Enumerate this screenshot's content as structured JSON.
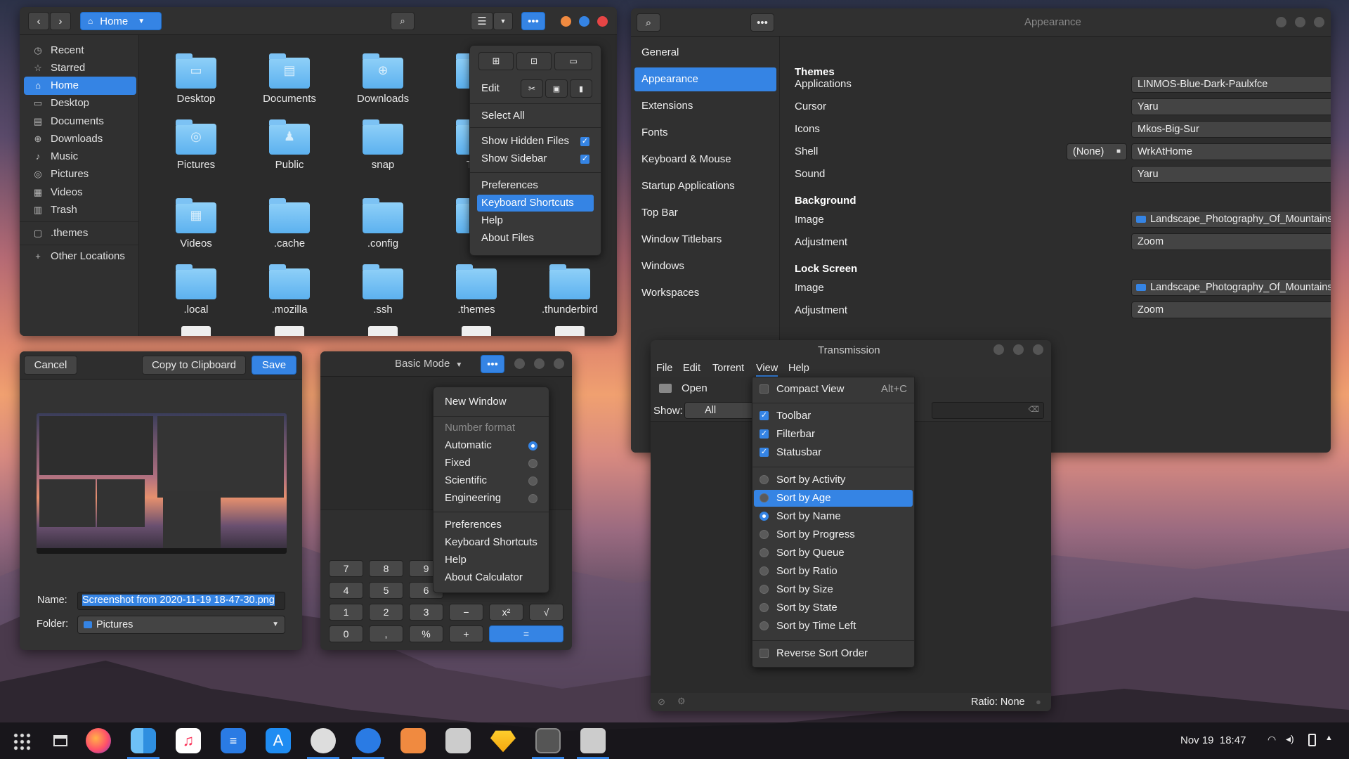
{
  "files": {
    "path": "Home",
    "sidebar": [
      {
        "label": "Recent",
        "icon": "clock-icon"
      },
      {
        "label": "Starred",
        "icon": "star-icon"
      },
      {
        "label": "Home",
        "icon": "home-icon"
      },
      {
        "label": "Desktop",
        "icon": "desktop-icon"
      },
      {
        "label": "Documents",
        "icon": "document-icon"
      },
      {
        "label": "Downloads",
        "icon": "download-icon"
      },
      {
        "label": "Music",
        "icon": "music-icon"
      },
      {
        "label": "Pictures",
        "icon": "camera-icon"
      },
      {
        "label": "Videos",
        "icon": "film-icon"
      },
      {
        "label": "Trash",
        "icon": "trash-icon"
      },
      {
        "label": ".themes",
        "icon": "folder-icon"
      },
      {
        "label": "Other Locations",
        "icon": "plus-icon"
      }
    ],
    "folders": [
      "Desktop",
      "Documents",
      "Downloads",
      "gi",
      "Pictures",
      "Public",
      "snap",
      "Tem",
      "Videos",
      ".cache",
      ".config",
      ".gi",
      ".local",
      ".mozilla",
      ".ssh",
      ".themes",
      ".thunderbird"
    ],
    "menu": {
      "edit": "Edit",
      "select_all": "Select All",
      "show_hidden": "Show Hidden Files",
      "show_sidebar": "Show Sidebar",
      "preferences": "Preferences",
      "shortcuts": "Keyboard Shortcuts",
      "help": "Help",
      "about": "About Files"
    }
  },
  "appearance": {
    "title": "Appearance",
    "nav": [
      "General",
      "Appearance",
      "Extensions",
      "Fonts",
      "Keyboard & Mouse",
      "Startup Applications",
      "Top Bar",
      "Window Titlebars",
      "Windows",
      "Workspaces"
    ],
    "themes": "Themes",
    "applications": "Applications",
    "applications_value": "LINMOS-Blue-Dark-Paulxfce",
    "cursor": "Cursor",
    "cursor_value": "Yaru",
    "icons": "Icons",
    "icons_value": "Mkos-Big-Sur",
    "shell": "Shell",
    "shell_none": "(None)",
    "shell_value": "WrkAtHome",
    "sound": "Sound",
    "sound_value": "Yaru",
    "background": "Background",
    "image": "Image",
    "image_value": "Landscape_Photography_Of_Mountains_by_Simon_Berger.jpg",
    "adjustment": "Adjustment",
    "adjustment_value": "Zoom",
    "lock_screen": "Lock Screen"
  },
  "screenshot": {
    "cancel": "Cancel",
    "copy": "Copy to Clipboard",
    "save": "Save",
    "name_label": "Name:",
    "name_value": "Screenshot from 2020-11-19 18-47-30.png",
    "folder_label": "Folder:",
    "folder_value": "Pictures"
  },
  "calculator": {
    "mode": "Basic Mode",
    "menu": {
      "new_window": "New Window",
      "number_format": "Number format",
      "automatic": "Automatic",
      "fixed": "Fixed",
      "scientific": "Scientific",
      "engineering": "Engineering",
      "preferences": "Preferences",
      "shortcuts": "Keyboard Shortcuts",
      "help": "Help",
      "about": "About Calculator"
    },
    "keys": [
      [
        "7",
        "8",
        "9"
      ],
      [
        "4",
        "5",
        "6"
      ],
      [
        "1",
        "2",
        "3",
        "−",
        "x²",
        "√"
      ],
      [
        "0",
        ",",
        "%",
        "+",
        "="
      ]
    ]
  },
  "transmission": {
    "title": "Transmission",
    "menubar": [
      "File",
      "Edit",
      "Torrent",
      "View",
      "Help"
    ],
    "open": "Open",
    "show": "Show:",
    "all": "All",
    "ratio": "Ratio: None",
    "view_menu": {
      "compact": "Compact View",
      "compact_key": "Alt+C",
      "toolbar": "Toolbar",
      "filterbar": "Filterbar",
      "statusbar": "Statusbar",
      "sorts": [
        "Sort by Activity",
        "Sort by Age",
        "Sort by Name",
        "Sort by Progress",
        "Sort by Queue",
        "Sort by Ratio",
        "Sort by Size",
        "Sort by State",
        "Sort by Time Left"
      ],
      "reverse": "Reverse Sort Order"
    }
  },
  "taskbar": {
    "date": "Nov 19",
    "time": "18:47"
  }
}
